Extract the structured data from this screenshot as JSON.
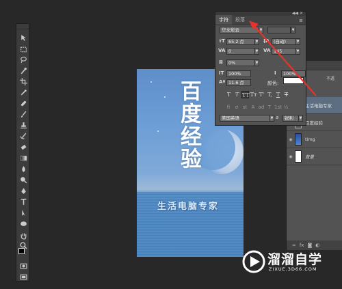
{
  "character_panel": {
    "tabs": [
      "字符",
      "段落"
    ],
    "font_family": "华文彩云",
    "font_size": "65.2 点",
    "leading": "(自动)",
    "kerning": "0",
    "tracking": "145",
    "vertical_scale": "0%",
    "horizontal_scale_1": "100%",
    "horizontal_scale_2": "100%",
    "baseline_shift": "11.6 点",
    "color_label": "颜色:",
    "language": "美国英语",
    "antialias_prefix": "a",
    "antialias": "锐利",
    "style_buttons": [
      "T",
      "T",
      "TT",
      "Tт",
      "T'",
      "T,",
      "T",
      "T"
    ],
    "ot_buttons": [
      "fi",
      "σ",
      "st",
      "A",
      "ad",
      "T",
      "1st",
      "½"
    ]
  },
  "layers_panel": {
    "filter_partial": "不透",
    "layers": [
      {
        "name": "生活电脑专家",
        "selected": true
      },
      {
        "name": "百度经验",
        "selected": false
      },
      {
        "name": "timg",
        "selected": false
      },
      {
        "name": "背景",
        "selected": false
      }
    ]
  },
  "canvas": {
    "title_text": "百度经验",
    "subtitle_text": "生活电脑专家"
  },
  "watermark": {
    "name": "溜溜自学",
    "url": "ZIXUE.3D66.COM"
  },
  "colors": {
    "arrow": "#e8322c",
    "selected_layer": "#5d6e82",
    "panel_bg": "#535353"
  }
}
